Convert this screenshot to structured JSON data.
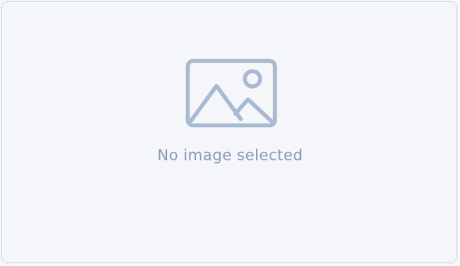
{
  "placeholder": {
    "message": "No image selected",
    "icon": "image-icon"
  },
  "colors": {
    "background": "#f5f6fa",
    "border": "#d3dbe7",
    "icon": "#a9bbd2",
    "text": "#8a9cb6"
  }
}
